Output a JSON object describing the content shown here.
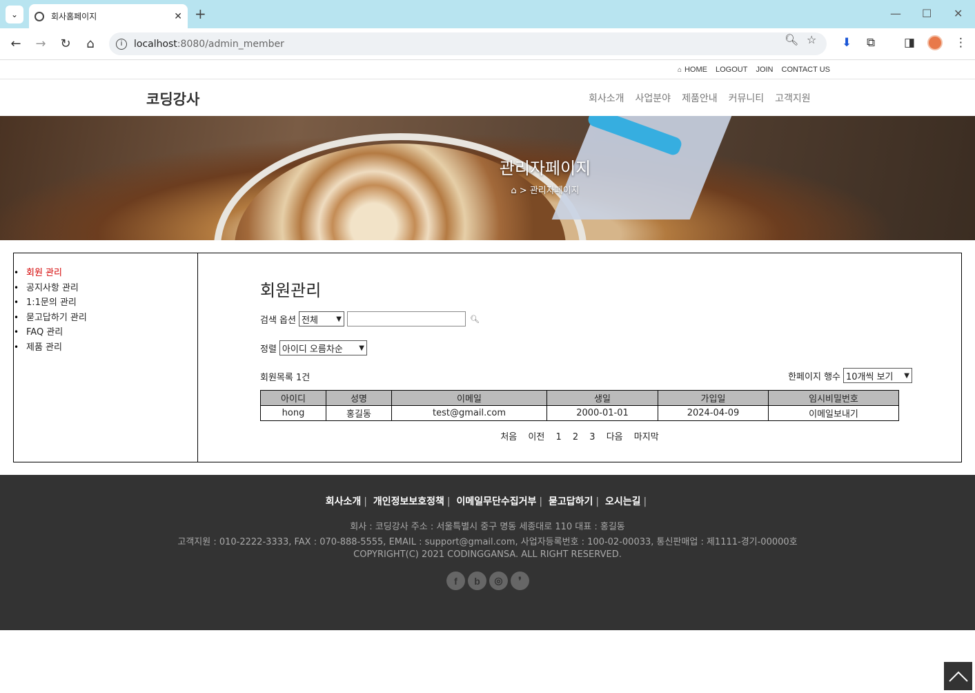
{
  "browser": {
    "tab_title": "회사홈페이지",
    "url_host": "localhost",
    "url_path": ":8080/admin_member"
  },
  "util_links": {
    "home": "HOME",
    "logout": "LOGOUT",
    "join": "JOIN",
    "contact": "CONTACT US"
  },
  "header": {
    "logo": "코딩강사",
    "nav": [
      "회사소개",
      "사업분야",
      "제품안내",
      "커뮤니티",
      "고객지원"
    ]
  },
  "banner": {
    "title": "관리자페이지",
    "crumb": "> 관리자페이지"
  },
  "sidebar": {
    "items": [
      "회원 관리",
      "공지사항 관리",
      "1:1문의 관리",
      "묻고답하기 관리",
      "FAQ 관리",
      "제품 관리"
    ],
    "active_index": 0
  },
  "main": {
    "title": "회원관리",
    "search_label": "검색 옵션",
    "search_option": "전체",
    "search_value": "",
    "sort_label": "정렬",
    "sort_option": "아이디 오름차순",
    "count_text": "회원목록 1건",
    "perpage_label": "한페이지 행수",
    "perpage_option": "10개씩 보기"
  },
  "table": {
    "headers": [
      "아이디",
      "성명",
      "이메일",
      "생일",
      "가입일",
      "임시비밀번호"
    ],
    "rows": [
      [
        "hong",
        "홍길동",
        "test@gmail.com",
        "2000-01-01",
        "2024-04-09",
        "이메일보내기"
      ]
    ]
  },
  "pager": {
    "first": "처음",
    "prev": "이전",
    "pages": [
      "1",
      "2",
      "3"
    ],
    "next": "다음",
    "last": "마지막"
  },
  "footer": {
    "links": [
      "회사소개",
      "개인정보보호정책",
      "이메일무단수집거부",
      "묻고답하기",
      "오시는길"
    ],
    "line1": "회사 : 코딩강사    주소 : 서울특별시 중구 명동 세종대로 110    대표 : 홍길동",
    "line2": "고객지원 : 010-2222-3333, FAX : 070-888-5555, EMAIL : support@gmail.com, 사업자등록번호 : 100-02-00033, 통신판매업 : 제1111-경기-00000호",
    "line3": "COPYRIGHT(C) 2021 CODINGGANSA. ALL RIGHT RESERVED.",
    "social": [
      "facebook-icon",
      "blog-icon",
      "instagram-icon",
      "kakao-icon"
    ]
  }
}
